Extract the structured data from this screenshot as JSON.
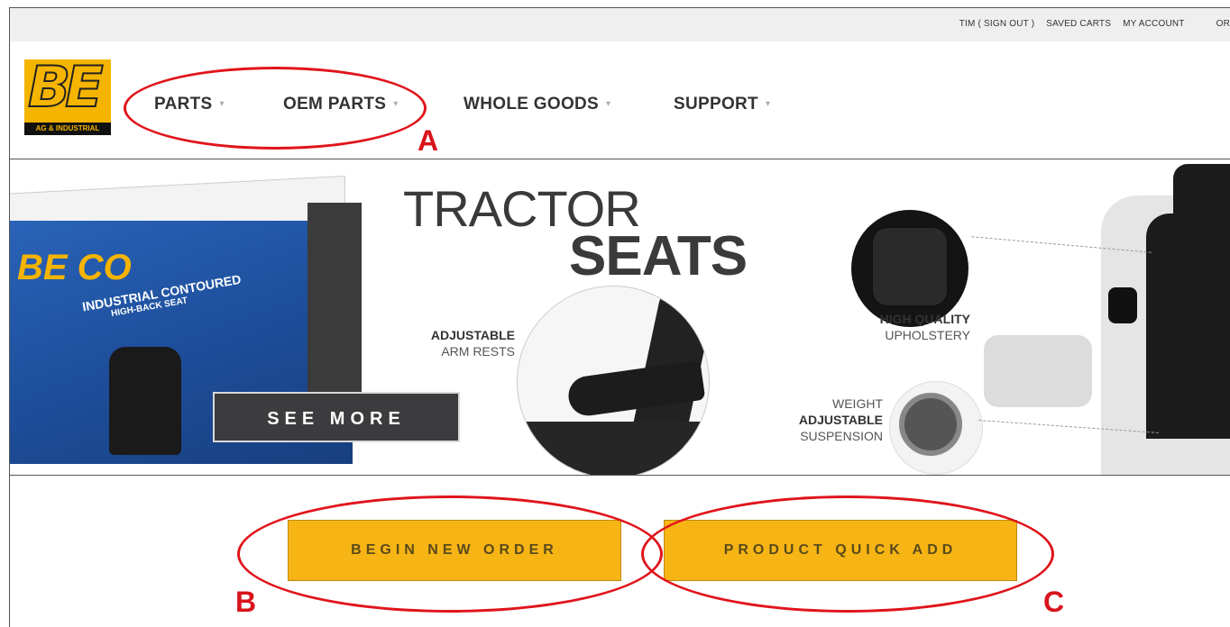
{
  "utility_bar": {
    "links": [
      "TIM ( SIGN OUT )",
      "SAVED CARTS",
      "MY ACCOUNT",
      "OR"
    ]
  },
  "logo": {
    "mark": "BE",
    "tagline": "AG & INDUSTRIAL"
  },
  "nav": {
    "items": [
      {
        "label": "PARTS"
      },
      {
        "label": "OEM PARTS"
      },
      {
        "label": "WHOLE GOODS"
      },
      {
        "label": "SUPPORT"
      }
    ]
  },
  "banner": {
    "headline_light": "TRACTOR",
    "headline_bold": "SEATS",
    "box_brand": "BE CO",
    "box_text_1": "INDUSTRIAL CONTOURED",
    "box_text_2": "HIGH-BACK SEAT",
    "see_more_label": "SEE MORE",
    "features": {
      "armrests": {
        "bold": "ADJUSTABLE",
        "light": "ARM RESTS"
      },
      "upholstery": {
        "bold": "HIGH QUALITY",
        "light": "UPHOLSTERY"
      },
      "suspension": {
        "top": "WEIGHT",
        "bold": "ADJUSTABLE",
        "light": "SUSPENSION"
      }
    }
  },
  "actions": {
    "begin_new_order": "BEGIN NEW ORDER",
    "product_quick_add": "PRODUCT QUICK ADD"
  },
  "annotations": {
    "a": "A",
    "b": "B",
    "c": "C"
  },
  "colors": {
    "accent": "#f7b515",
    "annotation": "#e0141b",
    "nav_text": "#333333"
  }
}
